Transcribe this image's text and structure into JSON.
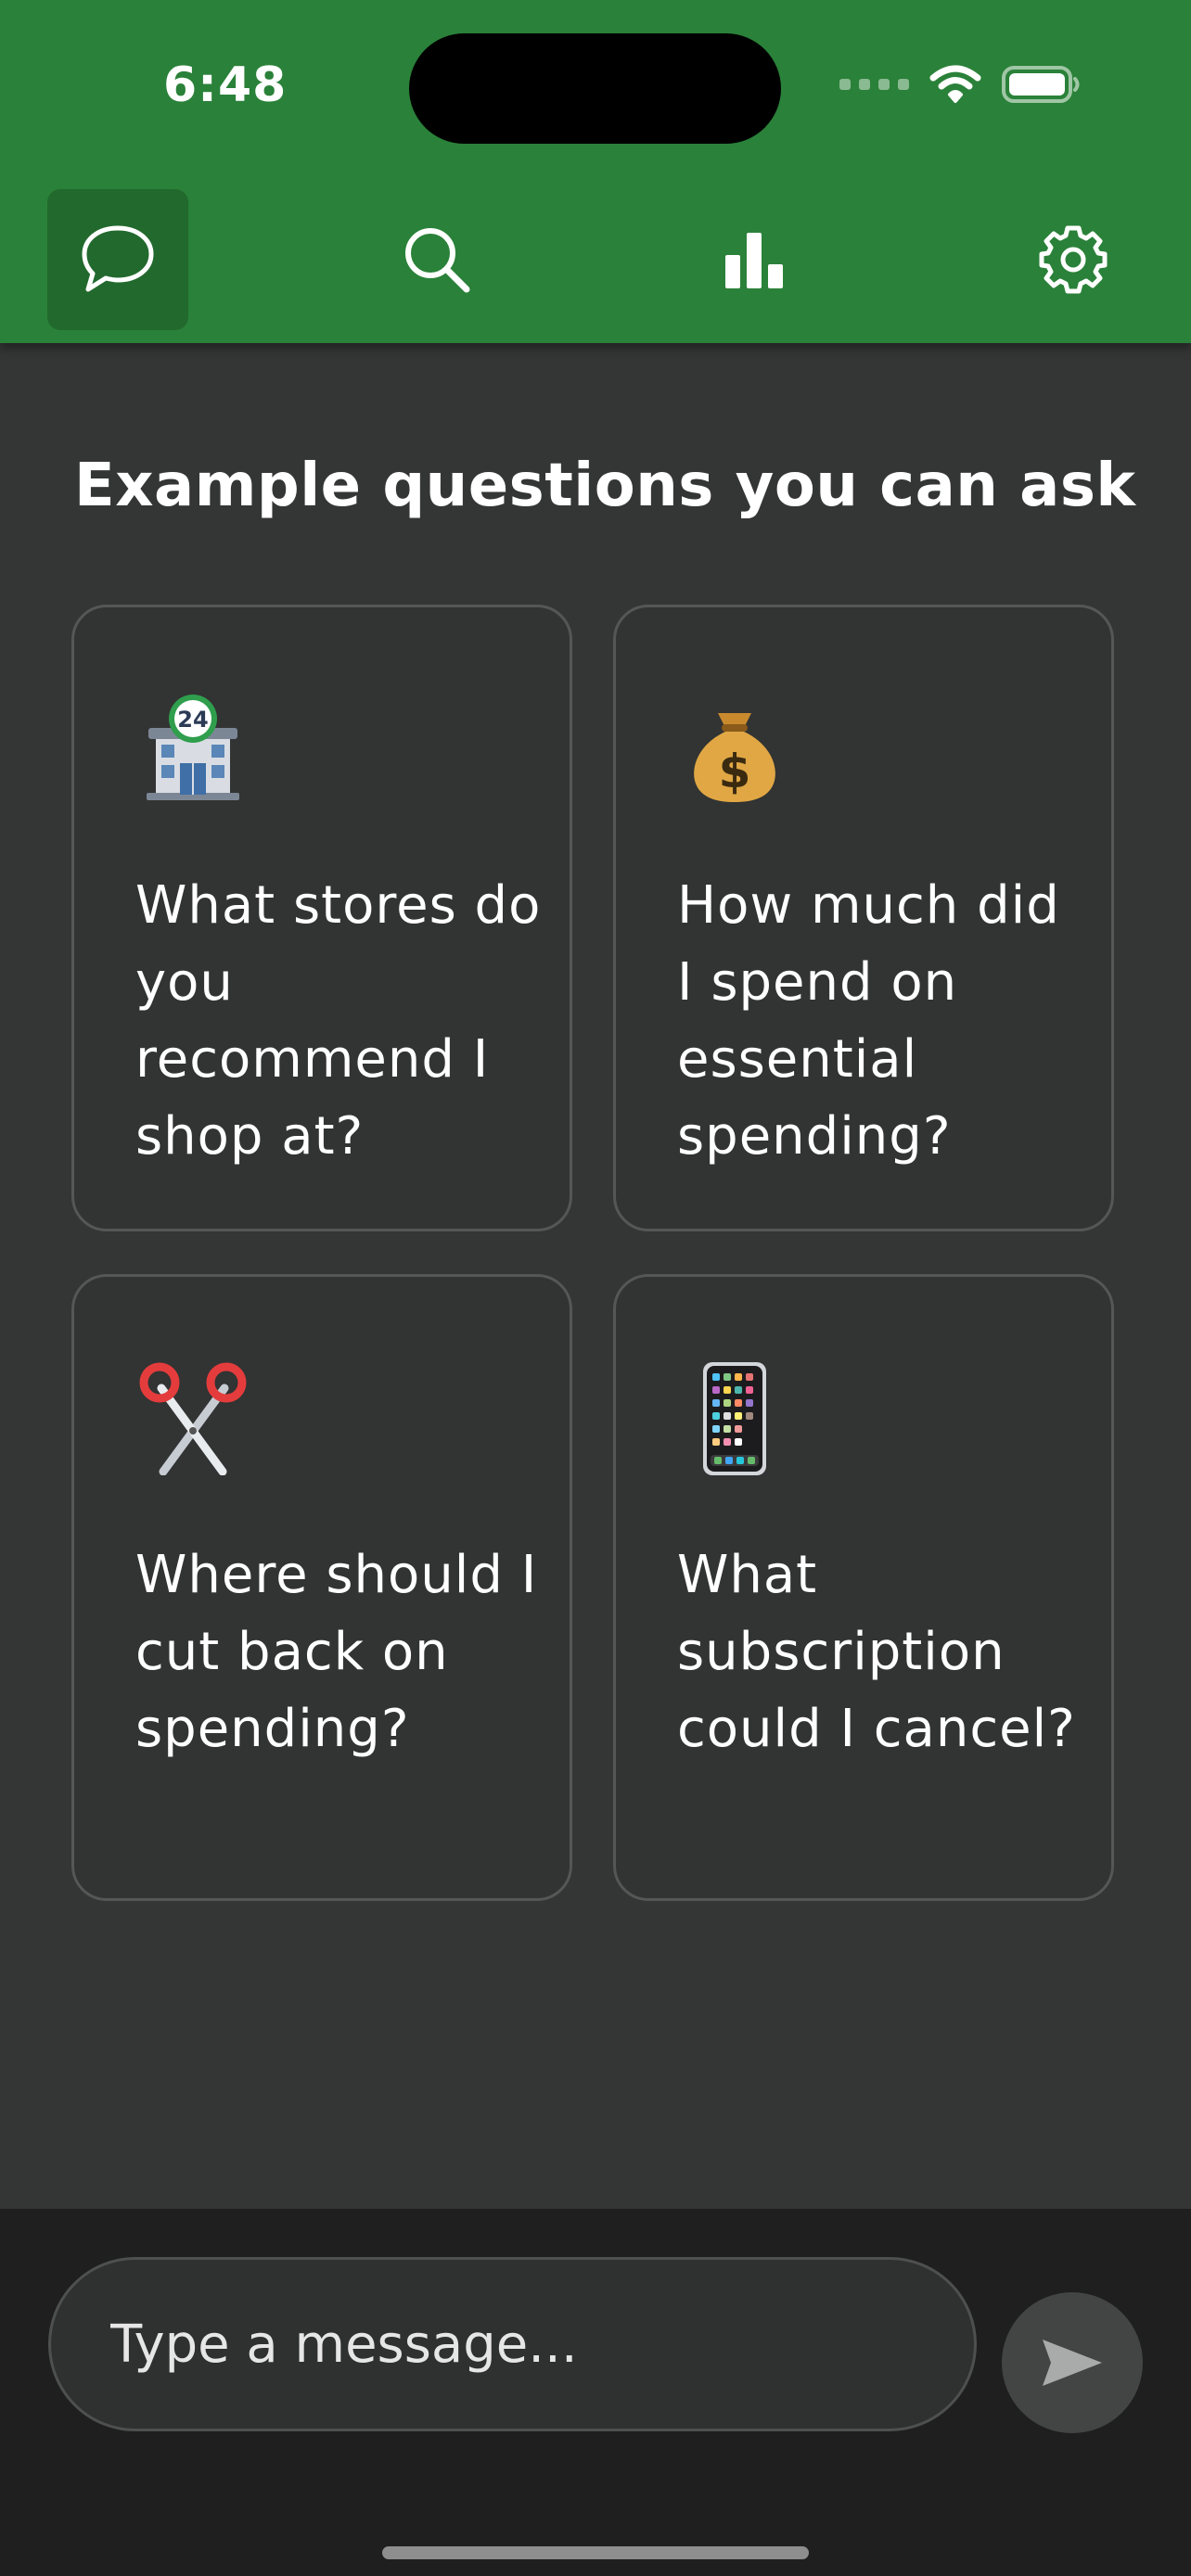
{
  "status_bar": {
    "time": "6:48"
  },
  "nav": {
    "tabs": [
      {
        "icon": "chat-bubble-icon",
        "active": true
      },
      {
        "icon": "search-icon",
        "active": false
      },
      {
        "icon": "bar-chart-icon",
        "active": false
      },
      {
        "icon": "gear-icon",
        "active": false
      }
    ]
  },
  "main": {
    "title": "Example questions you can ask",
    "cards": [
      {
        "icon": "convenience-store-icon",
        "text": "What stores do you recommend I shop at?"
      },
      {
        "icon": "money-bag-icon",
        "text": "How much did I spend on essential spending?"
      },
      {
        "icon": "scissors-icon",
        "text": "Where should I cut back on spending?"
      },
      {
        "icon": "mobile-phone-icon",
        "text": "What subscription could I cancel?"
      }
    ]
  },
  "composer": {
    "placeholder": "Type a message..."
  },
  "colors": {
    "header_green": "#2a8139",
    "active_tab": "#22692e",
    "background": "#343535",
    "card_border": "#555656",
    "composer_bg": "#1e1f1e"
  }
}
